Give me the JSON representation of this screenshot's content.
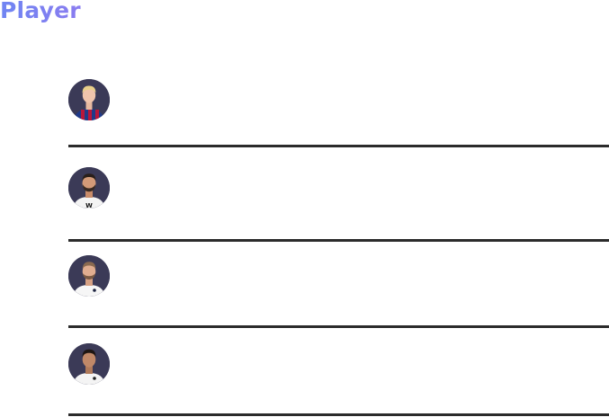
{
  "header": {
    "title": "Player"
  },
  "colors": {
    "title_gradient_start": "#6f85f2",
    "title_gradient_end": "#8a7cf0",
    "avatar_background": "#3b3a57",
    "divider": "#2b2b2b"
  },
  "players": [
    {
      "kit": "blue-red-striped-shirt"
    },
    {
      "kit": "white-shirt-black-w-logo"
    },
    {
      "kit": "white-shirt-crest"
    },
    {
      "kit": "white-shirt-crest"
    }
  ]
}
